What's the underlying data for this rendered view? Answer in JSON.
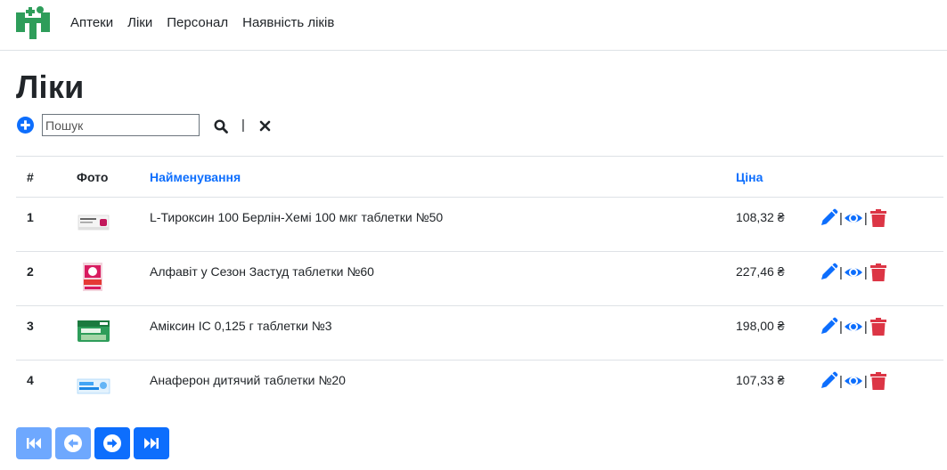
{
  "nav": {
    "links": [
      "Аптеки",
      "Ліки",
      "Персонал",
      "Наявність ліків"
    ]
  },
  "page": {
    "title": "Ліки"
  },
  "search": {
    "placeholder": "Пошук",
    "value": "",
    "separator": "|"
  },
  "table": {
    "headers": {
      "num": "#",
      "photo": "Фото",
      "name": "Найменування",
      "price": "Ціна"
    },
    "rows": [
      {
        "num": "1",
        "name": "L-Тироксин 100 Берлін-Хемі 100 мкг таблетки №50",
        "price": "108,32 ₴",
        "photo_icon": "white-box-photo"
      },
      {
        "num": "2",
        "name": "Алфавіт у Сезон Застуд таблетки №60",
        "price": "227,46 ₴",
        "photo_icon": "red-box-photo"
      },
      {
        "num": "3",
        "name": "Аміксин ІС 0,125 г таблетки №3",
        "price": "198,00 ₴",
        "photo_icon": "green-box-photo"
      },
      {
        "num": "4",
        "name": "Анаферон дитячий таблетки №20",
        "price": "107,33 ₴",
        "photo_icon": "blue-box-photo"
      }
    ],
    "action_separator": "|"
  },
  "pager": {
    "buttons": [
      "first-page-icon",
      "previous-page-icon",
      "next-page-icon",
      "last-page-icon"
    ]
  },
  "colors": {
    "primary": "#0d6efd",
    "primary_disabled": "#6ea8fe",
    "danger": "#dc3545",
    "text": "#212529",
    "border": "#dee2e6",
    "logo_green": "#2e9d5a"
  }
}
